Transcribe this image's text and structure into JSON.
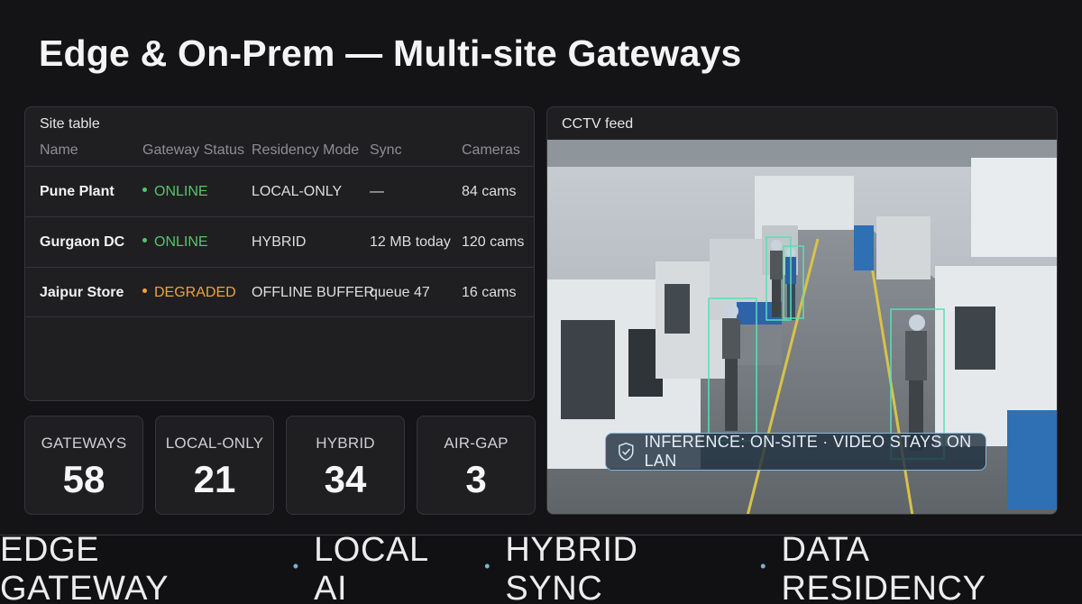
{
  "page": {
    "title": "Edge & On-Prem — Multi-site Gateways"
  },
  "site_table": {
    "title": "Site table",
    "columns": [
      "Name",
      "Gateway Status",
      "Residency Mode",
      "Sync",
      "Cameras"
    ],
    "rows": [
      {
        "name": "Pune Plant",
        "status": "ONLINE",
        "status_color": "#56c46a",
        "residency": "LOCAL-ONLY",
        "sync": "—",
        "cameras": "84 cams"
      },
      {
        "name": "Gurgaon DC",
        "status": "ONLINE",
        "status_color": "#56c46a",
        "residency": "HYBRID",
        "sync": "12 MB today",
        "cameras": "120 cams"
      },
      {
        "name": "Jaipur Store",
        "status": "DEGRADED",
        "status_color": "#f0a23c",
        "residency": "OFFLINE BUFFER",
        "sync": "queue 47",
        "cameras": "16 cams"
      }
    ]
  },
  "stats": [
    {
      "label": "GATEWAYS",
      "value": "58"
    },
    {
      "label": "LOCAL-ONLY",
      "value": "21"
    },
    {
      "label": "HYBRID",
      "value": "34"
    },
    {
      "label": "AIR-GAP",
      "value": "3"
    }
  ],
  "cctv": {
    "title": "CCTV feed",
    "badge_icon": "shield-check-icon",
    "badge_text": "INFERENCE: ON-SITE · VIDEO STAYS ON LAN",
    "detection_color": "#59e0b8"
  },
  "footer": {
    "items": [
      "EDGE GATEWAY",
      "LOCAL AI",
      "HYBRID SYNC",
      "DATA RESIDENCY"
    ],
    "separator": "•"
  }
}
